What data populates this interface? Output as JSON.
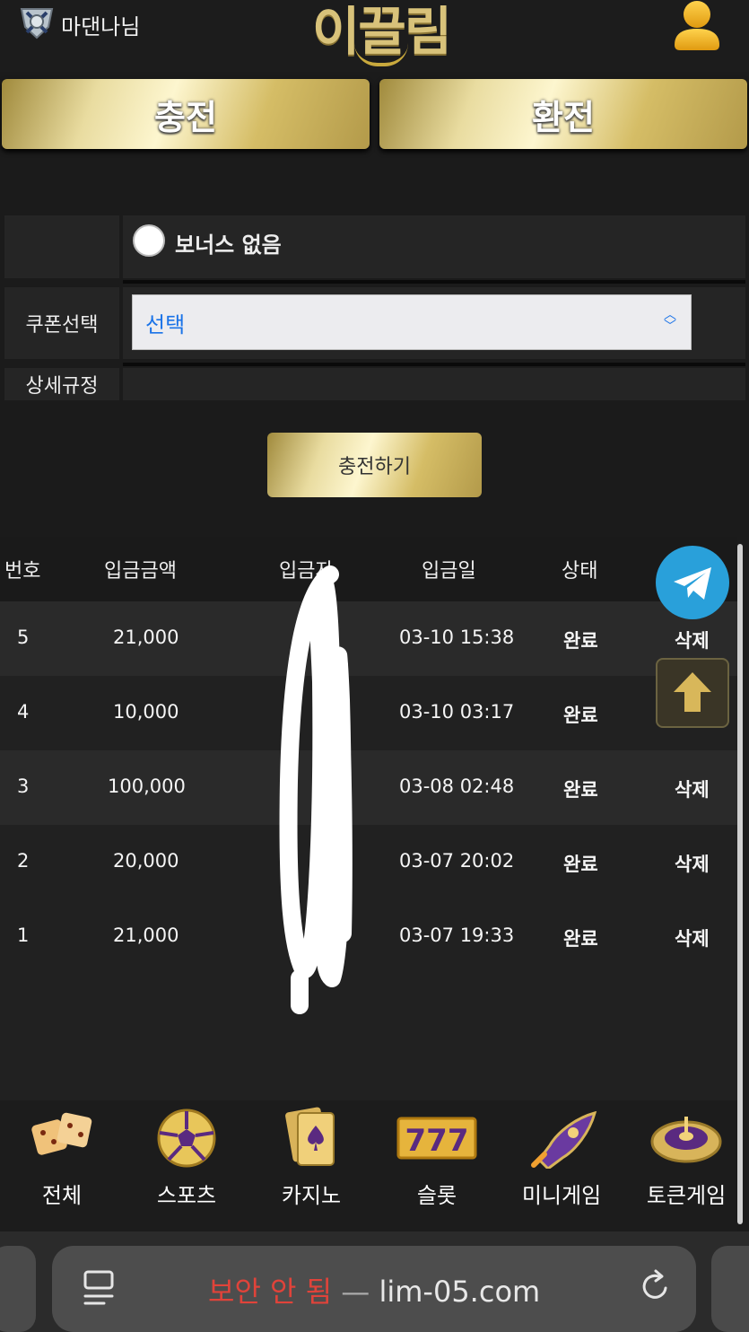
{
  "header": {
    "username": "마댄나님",
    "logo": "이끌림"
  },
  "tabs": {
    "charge": "충전",
    "exchange": "환전"
  },
  "form": {
    "bonus_option": "보너스 없음",
    "coupon_label": "쿠폰선택",
    "coupon_value": "선택",
    "rules_label": "상세규정",
    "submit": "충전하기"
  },
  "table": {
    "headers": [
      "번호",
      "입금금액",
      "입금자",
      "입금일",
      "상태"
    ],
    "rows": [
      {
        "no": "5",
        "amount": "21,000",
        "date": "03-10 15:38",
        "status": "완료",
        "action": "삭제"
      },
      {
        "no": "4",
        "amount": "10,000",
        "date": "03-10 03:17",
        "status": "완료",
        "action": ""
      },
      {
        "no": "3",
        "amount": "100,000",
        "date": "03-08 02:48",
        "status": "완료",
        "action": "삭제"
      },
      {
        "no": "2",
        "amount": "20,000",
        "date": "03-07 20:02",
        "status": "완료",
        "action": "삭제"
      },
      {
        "no": "1",
        "amount": "21,000",
        "date": "03-07 19:33",
        "status": "완료",
        "action": "삭제"
      }
    ]
  },
  "bottom_nav": [
    {
      "label": "전체",
      "icon": "dice-icon"
    },
    {
      "label": "스포츠",
      "icon": "soccer-ball-icon"
    },
    {
      "label": "카지노",
      "icon": "cards-icon"
    },
    {
      "label": "슬롯",
      "icon": "slot-777-icon"
    },
    {
      "label": "미니게임",
      "icon": "rocket-icon"
    },
    {
      "label": "토큰게임",
      "icon": "roulette-icon"
    }
  ],
  "browser": {
    "security_warning": "보안 안 됨",
    "separator": "—",
    "url": "lim-05.com"
  },
  "colors": {
    "gold": "#d8c27a",
    "telegram": "#29a0da",
    "link_blue": "#1a73e8",
    "warning_red": "#e0433a"
  }
}
